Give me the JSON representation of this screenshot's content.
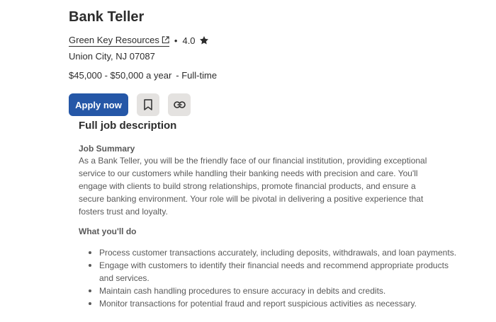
{
  "job": {
    "title": "Bank Teller",
    "company": "Green Key Resources",
    "rating": "4.0",
    "location": "Union City, NJ 07087",
    "salary": "$45,000 - $50,000 a year",
    "job_type": "- Full-time"
  },
  "actions": {
    "apply_label": "Apply now",
    "save_icon": "bookmark-icon",
    "copy_link_icon": "link-icon"
  },
  "description": {
    "heading": "Full job description",
    "summary_label": "Job Summary",
    "summary_text": "As a Bank Teller, you will be the friendly face of our financial institution, providing exceptional service to our customers while handling their banking needs with precision and care. You'll engage with clients to build strong relationships, promote financial products, and ensure a secure banking environment. Your role will be pivotal in delivering a positive experience that fosters trust and loyalty.",
    "duties_label": "What you'll do",
    "duties": [
      "Process customer transactions accurately, including deposits, withdrawals, and loan payments.",
      "Engage with customers to identify their financial needs and recommend appropriate products and services.",
      "Maintain cash handling procedures to ensure accuracy in debits and credits.",
      "Monitor transactions for potential fraud and report suspicious activities as necessary."
    ]
  },
  "colors": {
    "primary": "#2557a7",
    "icon_button_bg": "#e4e2e0",
    "text_dark": "#2d2d2d",
    "text_muted": "#595959"
  }
}
